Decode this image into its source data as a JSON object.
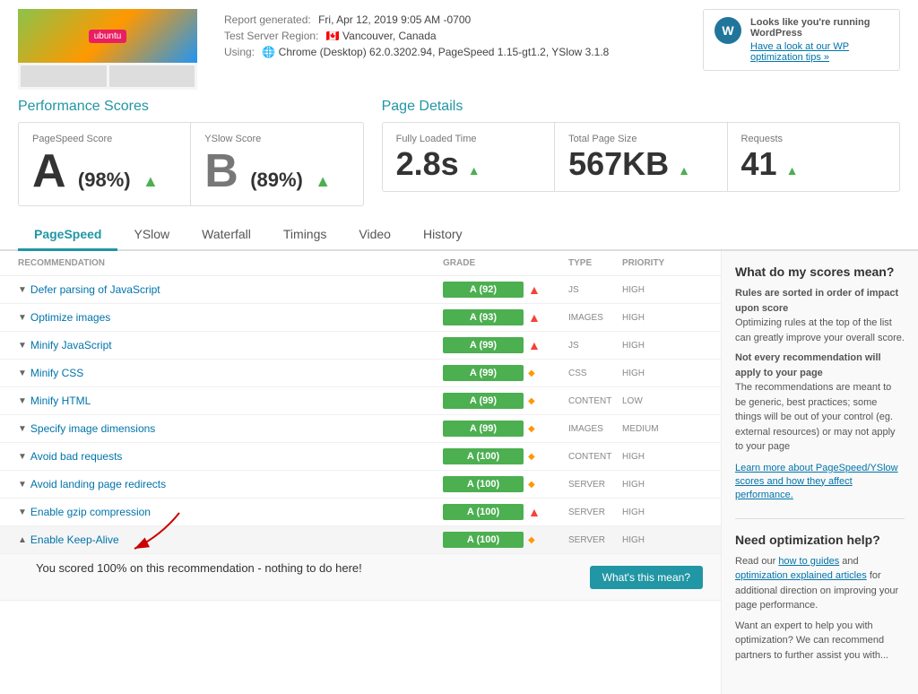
{
  "header": {
    "report_generated_label": "Report generated:",
    "report_generated_value": "Fri, Apr 12, 2019 9:05 AM -0700",
    "test_server_label": "Test Server Region:",
    "test_server_value": "Vancouver, Canada",
    "using_label": "Using:",
    "using_value": "Chrome (Desktop) 62.0.3202.94, PageSpeed 1.15-gt1.2, YSlow 3.1.8",
    "wp_notice_title": "Looks like you're running WordPress",
    "wp_notice_link": "Have a look at our WP optimization tips »"
  },
  "performance": {
    "title": "Performance Scores",
    "pagespeed_label": "PageSpeed Score",
    "pagespeed_value": "A (98%)",
    "pagespeed_arrow": "▲",
    "yslow_label": "YSlow Score",
    "yslow_value": "B (89%)",
    "yslow_arrow": "▲"
  },
  "page_details": {
    "title": "Page Details",
    "loaded_label": "Fully Loaded Time",
    "loaded_value": "2.8s",
    "loaded_arrow": "▲",
    "size_label": "Total Page Size",
    "size_value": "567KB",
    "size_arrow": "▲",
    "requests_label": "Requests",
    "requests_value": "41",
    "requests_arrow": "▲"
  },
  "tabs": [
    {
      "id": "pagespeed",
      "label": "PageSpeed",
      "active": true
    },
    {
      "id": "yslow",
      "label": "YSlow",
      "active": false
    },
    {
      "id": "waterfall",
      "label": "Waterfall",
      "active": false
    },
    {
      "id": "timings",
      "label": "Timings",
      "active": false
    },
    {
      "id": "video",
      "label": "Video",
      "active": false
    },
    {
      "id": "history",
      "label": "History",
      "active": false
    }
  ],
  "table": {
    "headers": {
      "recommendation": "Recommendation",
      "grade": "Grade",
      "type": "Type",
      "priority": "Priority"
    },
    "rows": [
      {
        "name": "Defer parsing of JavaScript",
        "grade": "A (92)",
        "icon_type": "arrow",
        "type": "JS",
        "priority": "HIGH",
        "expanded": false
      },
      {
        "name": "Optimize images",
        "grade": "A (93)",
        "icon_type": "arrow",
        "type": "IMAGES",
        "priority": "HIGH",
        "expanded": false
      },
      {
        "name": "Minify JavaScript",
        "grade": "A (99)",
        "icon_type": "arrow",
        "type": "JS",
        "priority": "HIGH",
        "expanded": false
      },
      {
        "name": "Minify CSS",
        "grade": "A (99)",
        "icon_type": "diamond",
        "type": "CSS",
        "priority": "HIGH",
        "expanded": false
      },
      {
        "name": "Minify HTML",
        "grade": "A (99)",
        "icon_type": "diamond",
        "type": "CONTENT",
        "priority": "LOW",
        "expanded": false
      },
      {
        "name": "Specify image dimensions",
        "grade": "A (99)",
        "icon_type": "diamond",
        "type": "IMAGES",
        "priority": "MEDIUM",
        "expanded": false
      },
      {
        "name": "Avoid bad requests",
        "grade": "A (100)",
        "icon_type": "diamond",
        "type": "CONTENT",
        "priority": "HIGH",
        "expanded": false
      },
      {
        "name": "Avoid landing page redirects",
        "grade": "A (100)",
        "icon_type": "diamond",
        "type": "SERVER",
        "priority": "HIGH",
        "expanded": false
      },
      {
        "name": "Enable gzip compression",
        "grade": "A (100)",
        "icon_type": "arrow",
        "type": "SERVER",
        "priority": "HIGH",
        "expanded": false
      },
      {
        "name": "Enable Keep-Alive",
        "grade": "A (100)",
        "icon_type": "diamond",
        "type": "SERVER",
        "priority": "HIGH",
        "expanded": true
      }
    ]
  },
  "expanded_row": {
    "text": "You scored 100% on this recommendation - nothing to do here!",
    "button": "What's this mean?"
  },
  "sidebar": {
    "box1_title": "What do my scores mean?",
    "box1_p1_label": "Rules are sorted in order of impact upon score",
    "box1_p1_text": "Optimizing rules at the top of the list can greatly improve your overall score.",
    "box1_p2_label": "Not every recommendation will apply to your page",
    "box1_p2_text": "The recommendations are meant to be generic, best practices; some things will be out of your control (eg. external resources) or may not apply to your page",
    "box1_link": "Learn more about PageSpeed/YSlow scores and how they affect performance.",
    "box2_title": "Need optimization help?",
    "box2_p1": "Read our ",
    "box2_link1": "how to guides",
    "box2_p1b": " and ",
    "box2_link2": "optimization explained articles",
    "box2_p1c": " for additional direction on improving your page performance.",
    "box2_p2": "Want an expert to help you with optimization? We can recommend partners to further assist you with..."
  }
}
